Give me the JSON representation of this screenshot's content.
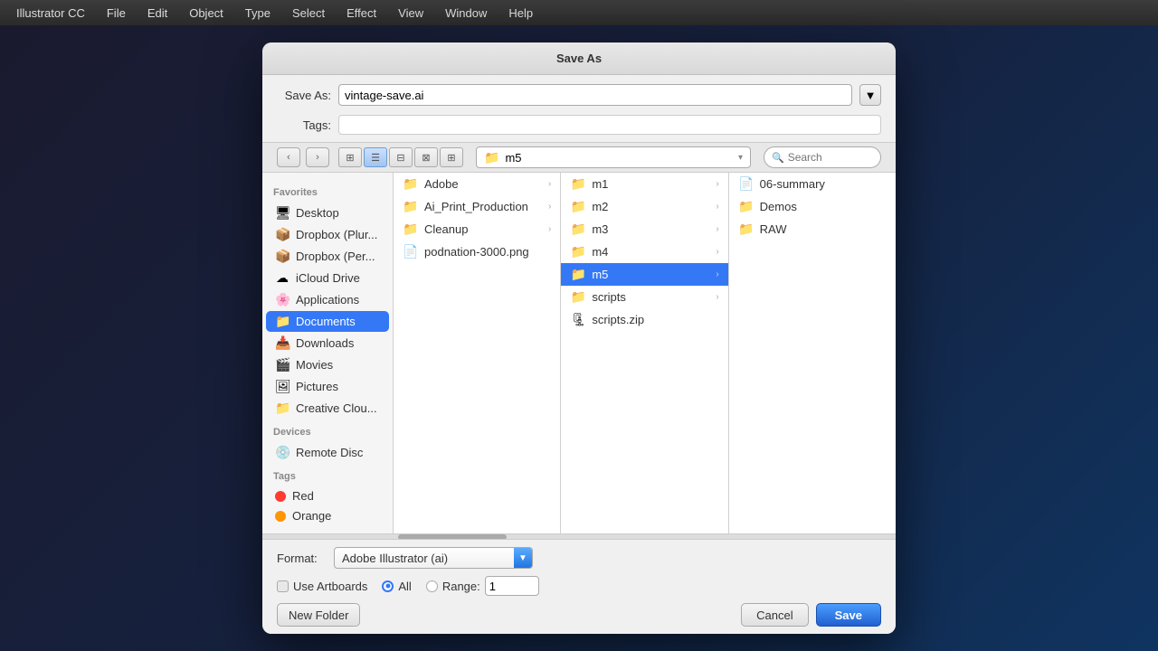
{
  "app": {
    "title": "Illustrator CC",
    "menus": [
      "Illustrator CC",
      "File",
      "Edit",
      "Object",
      "Type",
      "Select",
      "Effect",
      "View",
      "Window",
      "Help"
    ]
  },
  "dialog": {
    "title": "Save As",
    "save_as_label": "Save As:",
    "save_as_value": "vintage-save.ai",
    "tags_label": "Tags:",
    "tags_value": "",
    "tags_placeholder": ""
  },
  "toolbar": {
    "location": "m5",
    "search_placeholder": "Search"
  },
  "sidebar": {
    "favorites_label": "Favorites",
    "devices_label": "Devices",
    "tags_label": "Tags",
    "items": [
      {
        "id": "desktop",
        "label": "Desktop",
        "icon": "🖥"
      },
      {
        "id": "dropbox1",
        "label": "Dropbox (Plur...",
        "icon": "📦"
      },
      {
        "id": "dropbox2",
        "label": "Dropbox (Per...",
        "icon": "📦"
      },
      {
        "id": "icloud",
        "label": "iCloud Drive",
        "icon": "☁"
      },
      {
        "id": "applications",
        "label": "Applications",
        "icon": "🌸"
      },
      {
        "id": "documents",
        "label": "Documents",
        "icon": "📁",
        "active": true
      },
      {
        "id": "downloads",
        "label": "Downloads",
        "icon": "📥"
      },
      {
        "id": "movies",
        "label": "Movies",
        "icon": "🎬"
      },
      {
        "id": "pictures",
        "label": "Pictures",
        "icon": "🖼"
      },
      {
        "id": "creative",
        "label": "Creative Clou...",
        "icon": "📁"
      }
    ],
    "devices": [
      {
        "id": "remote-disc",
        "label": "Remote Disc",
        "icon": "💿"
      }
    ],
    "tags": [
      {
        "id": "red",
        "label": "Red",
        "color": "#ff3b30"
      },
      {
        "id": "orange",
        "label": "Orange",
        "color": "#ff9500"
      }
    ]
  },
  "columns": {
    "col1": {
      "items": [
        {
          "id": "adobe",
          "label": "Adobe",
          "icon": "📁",
          "has_arrow": true
        },
        {
          "id": "ai-print",
          "label": "Ai_Print_Production",
          "icon": "📁",
          "has_arrow": true
        },
        {
          "id": "cleanup",
          "label": "Cleanup",
          "icon": "📁",
          "has_arrow": true
        },
        {
          "id": "podnation",
          "label": "podnation-3000.png",
          "icon": "📄",
          "has_arrow": false
        }
      ]
    },
    "col2": {
      "items": [
        {
          "id": "m1",
          "label": "m1",
          "icon": "📁",
          "has_arrow": true
        },
        {
          "id": "m2",
          "label": "m2",
          "icon": "📁",
          "has_arrow": true
        },
        {
          "id": "m3",
          "label": "m3",
          "icon": "📁",
          "has_arrow": true
        },
        {
          "id": "m4",
          "label": "m4",
          "icon": "📁",
          "has_arrow": true
        },
        {
          "id": "m5",
          "label": "m5",
          "icon": "📁",
          "has_arrow": true,
          "selected": true
        },
        {
          "id": "scripts",
          "label": "scripts",
          "icon": "📁",
          "has_arrow": true
        },
        {
          "id": "scripts-zip",
          "label": "scripts.zip",
          "icon": "🗜",
          "has_arrow": false
        }
      ]
    },
    "col3": {
      "items": [
        {
          "id": "summary",
          "label": "06-summary",
          "icon": "📄",
          "has_arrow": false
        },
        {
          "id": "demos",
          "label": "Demos",
          "icon": "📁",
          "has_arrow": false
        },
        {
          "id": "raw",
          "label": "RAW",
          "icon": "📁",
          "has_arrow": false
        }
      ]
    }
  },
  "bottom": {
    "format_label": "Format:",
    "format_value": "Adobe Illustrator (ai)",
    "use_artboards_label": "Use Artboards",
    "all_label": "All",
    "range_label": "Range:",
    "range_value": "1",
    "new_folder_label": "New Folder",
    "cancel_label": "Cancel",
    "save_label": "Save"
  }
}
